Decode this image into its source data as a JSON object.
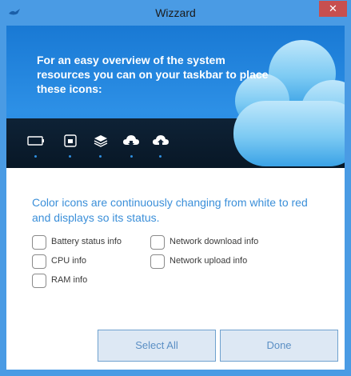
{
  "window": {
    "title": "Wizzard",
    "close_glyph": "✕",
    "app_icon": "bird-icon"
  },
  "banner": {
    "text": "For an easy overview of the system resources you can on your taskbar to place these icons:",
    "icons": [
      "battery-icon",
      "cpu-icon",
      "ram-layers-icon",
      "cloud-download-icon",
      "cloud-upload-icon"
    ]
  },
  "description": "Color icons are continuously changing from white to red and displays so its status.",
  "options": {
    "battery": "Battery status info",
    "cpu": "CPU info",
    "ram": "RAM info",
    "download": "Network download info",
    "upload": "Network upload info"
  },
  "buttons": {
    "select_all": "Select All",
    "done": "Done"
  },
  "colors": {
    "chrome": "#4a9be4",
    "banner": "#2d90e6",
    "taskbar": "#0e2236",
    "text_accent": "#3b8fd9",
    "close": "#c74f4f",
    "button_bg": "#dde8f4",
    "button_border": "#6fa1cf"
  }
}
